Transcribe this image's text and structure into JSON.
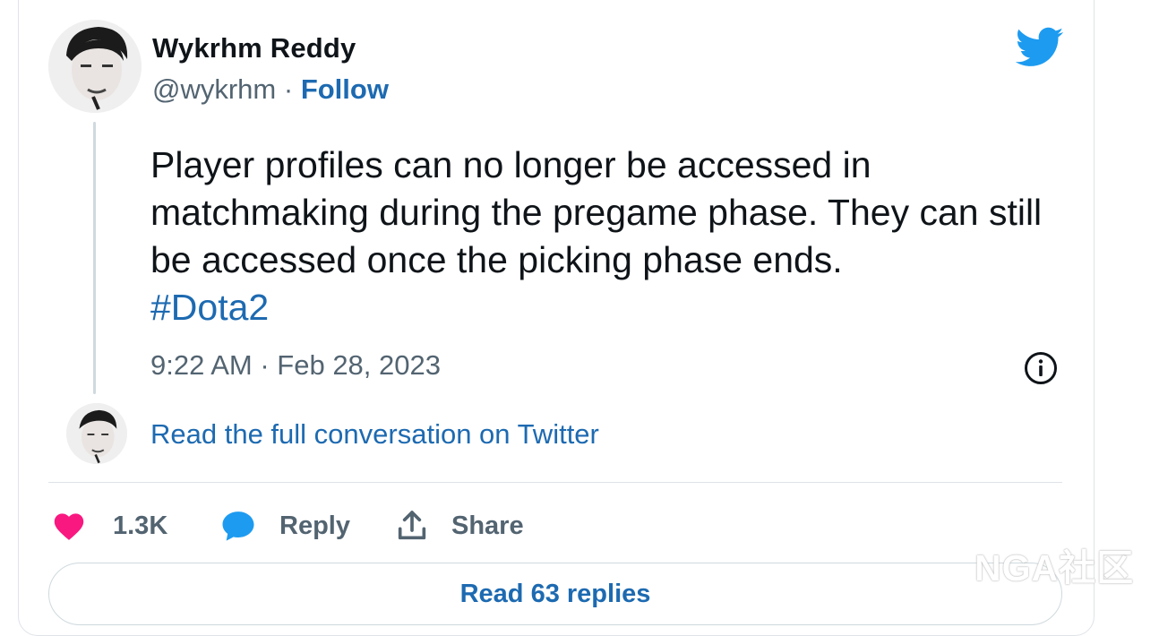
{
  "tweet": {
    "author_name": "Wykrhm Reddy",
    "handle": "@wykrhm",
    "separator": " · ",
    "follow_label": "Follow",
    "text": "Player profiles can no longer be accessed in matchmaking during the pregame phase. They can still be accessed once the picking phase ends.",
    "hashtag": "#Dota2",
    "timestamp": "9:22 AM · Feb 28, 2023"
  },
  "conversation": {
    "link_label": "Read the full conversation on Twitter"
  },
  "actions": {
    "likes": "1.3K",
    "reply_label": "Reply",
    "share_label": "Share"
  },
  "read_replies_label": "Read 63 replies",
  "watermark": "NGA社区",
  "icons": {
    "brand": "twitter-bird-icon",
    "info": "info-icon",
    "like": "heart-icon",
    "reply": "speech-bubble-icon",
    "share": "share-arrow-icon"
  },
  "colors": {
    "link_blue": "#1d6ab1",
    "twitter_blue": "#1d9bf0",
    "heart_pink": "#f91880",
    "muted_text": "#536471"
  }
}
